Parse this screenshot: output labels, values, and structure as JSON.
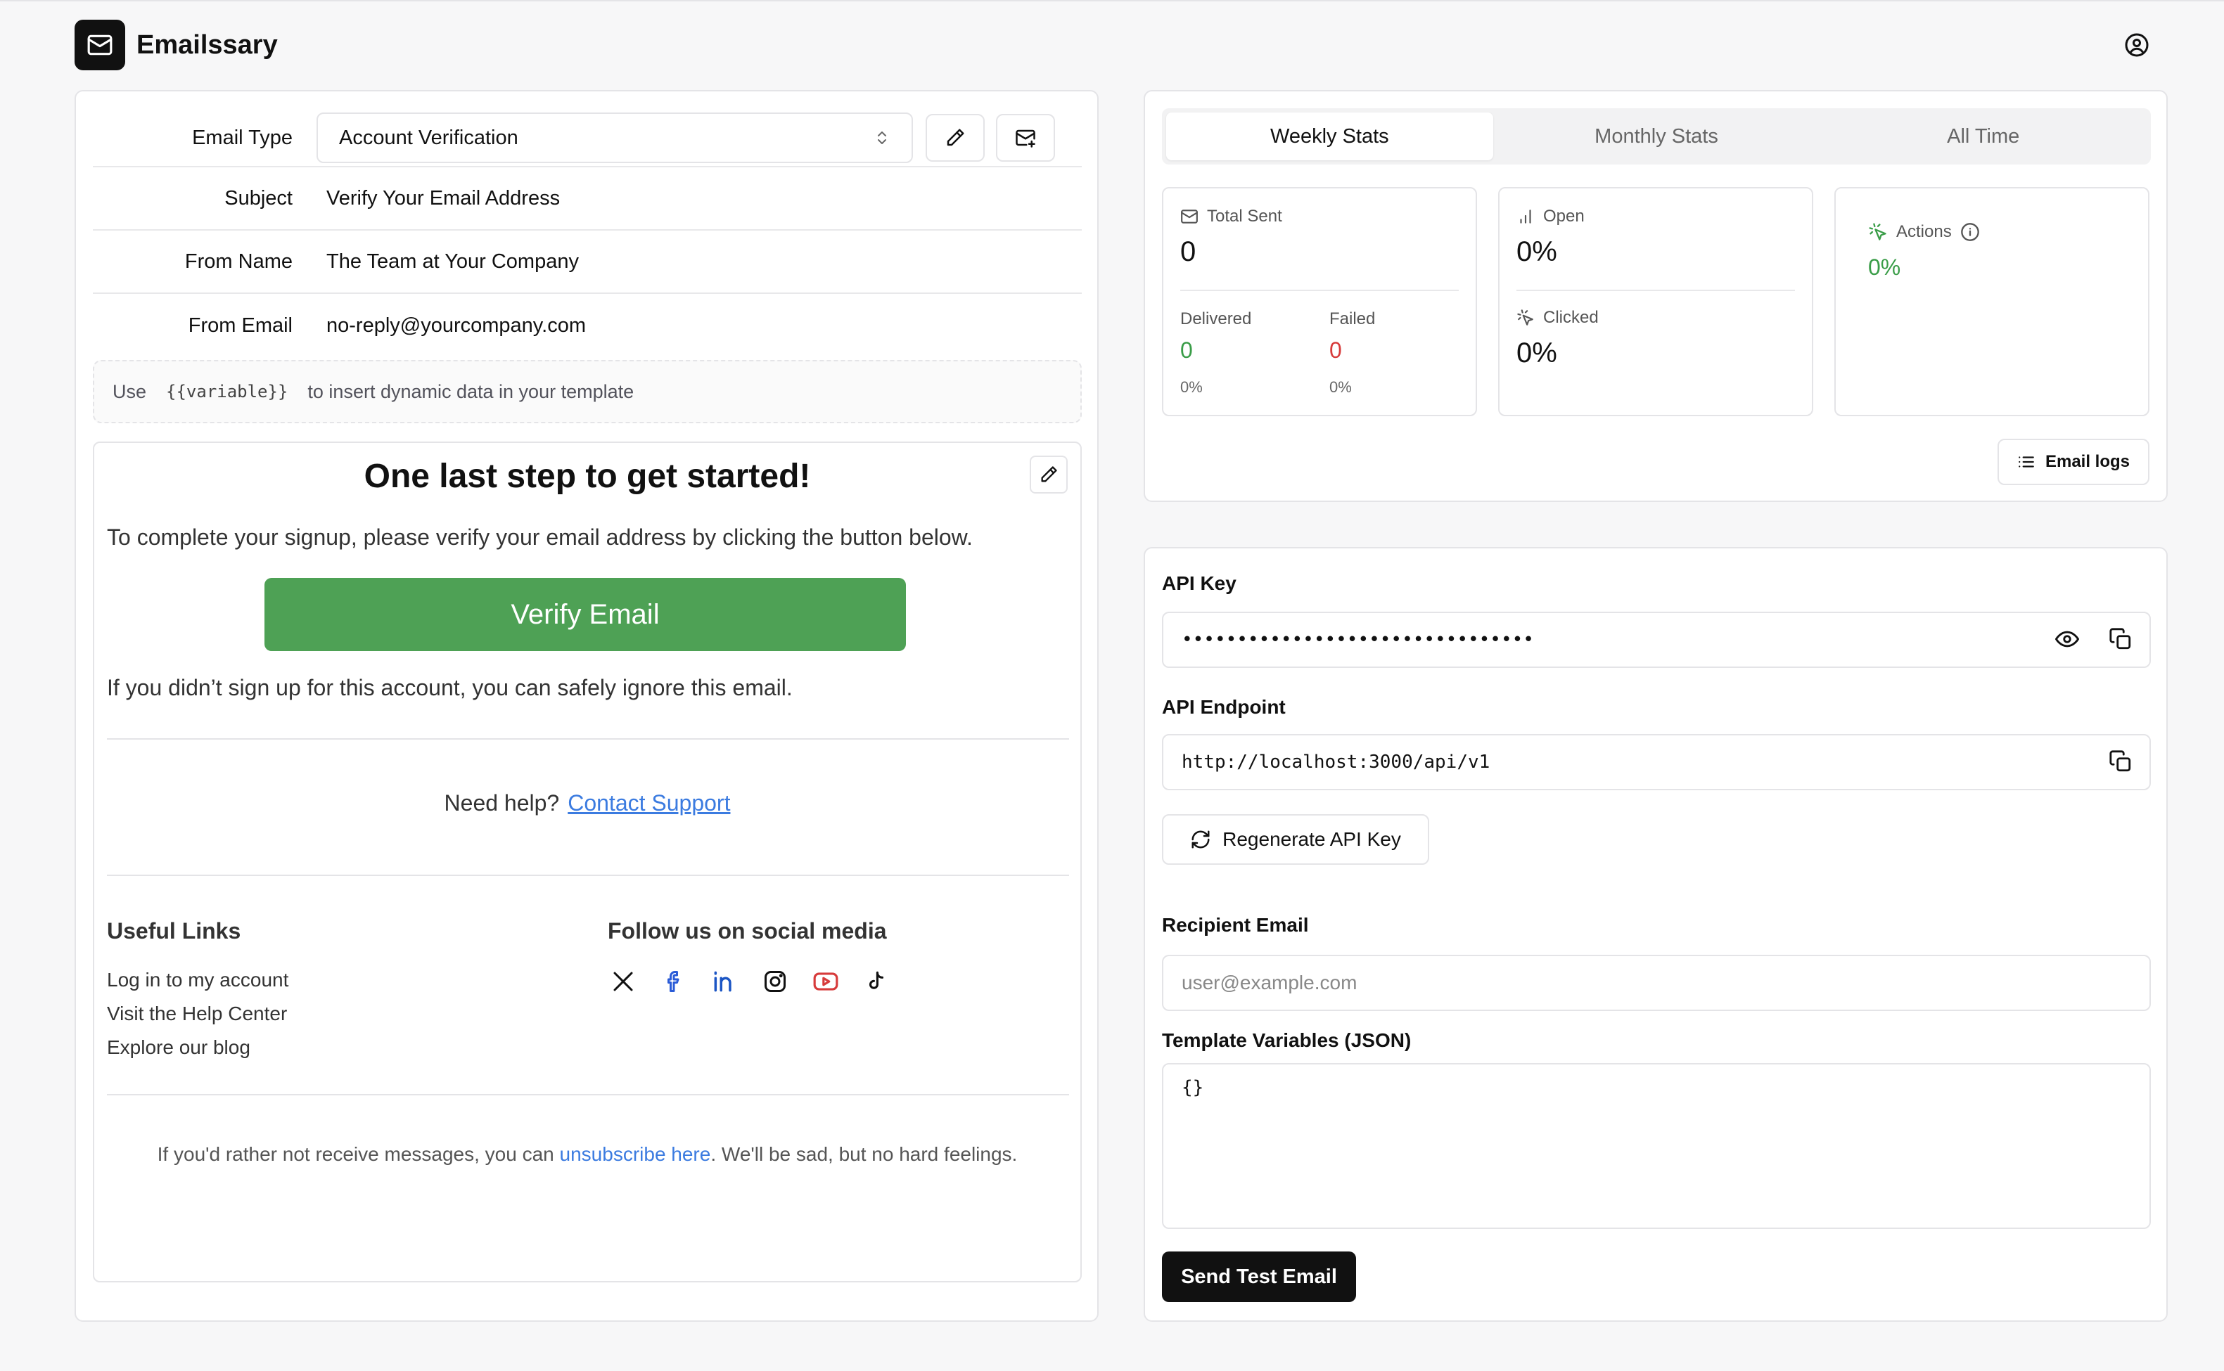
{
  "app": {
    "name": "Emailssary"
  },
  "form": {
    "email_type_label": "Email Type",
    "email_type_value": "Account Verification",
    "subject_label": "Subject",
    "subject_value": "Verify Your Email Address",
    "from_name_label": "From Name",
    "from_name_value": "The Team at Your Company",
    "from_email_label": "From Email",
    "from_email_value": "no-reply@yourcompany.com",
    "hint_prefix": "Use",
    "hint_code": "{{variable}}",
    "hint_suffix": "to insert dynamic data in your template"
  },
  "preview": {
    "title": "One last step to get started!",
    "intro": "To complete your signup, please verify your email address by clicking the button below.",
    "button": "Verify Email",
    "ignore": "If you didn’t sign up for this account, you can safely ignore this email.",
    "help_text": "Need help?",
    "help_link": "Contact Support",
    "useful_links_title": "Useful Links",
    "links": [
      "Log in to my account",
      "Visit the Help Center",
      "Explore our blog"
    ],
    "social_title": "Follow us on social media",
    "unsub_prefix": "If you'd rather not receive messages, you can",
    "unsub_link": "unsubscribe here",
    "unsub_suffix": ". We'll be sad, but no hard feelings."
  },
  "stats": {
    "tabs": [
      "Weekly Stats",
      "Monthly Stats",
      "All Time"
    ],
    "total_sent_label": "Total Sent",
    "total_sent": "0",
    "delivered_label": "Delivered",
    "delivered": "0",
    "delivered_pct": "0%",
    "failed_label": "Failed",
    "failed": "0",
    "failed_pct": "0%",
    "open_label": "Open",
    "open": "0%",
    "clicked_label": "Clicked",
    "clicked": "0%",
    "actions_label": "Actions",
    "actions": "0%",
    "email_logs": "Email logs"
  },
  "api": {
    "key_label": "API Key",
    "key_masked": "••••••••••••••••••••••••••••••••",
    "endpoint_label": "API Endpoint",
    "endpoint": "http://localhost:3000/api/v1",
    "regenerate": "Regenerate API Key",
    "recipient_label": "Recipient Email",
    "recipient_placeholder": "user@example.com",
    "vars_label": "Template Variables (JSON)",
    "vars_value": "{}",
    "send": "Send Test Email"
  },
  "colors": {
    "accent_green": "#4ea155",
    "link_blue": "#3b7be0",
    "fail_red": "#d73b3b"
  }
}
